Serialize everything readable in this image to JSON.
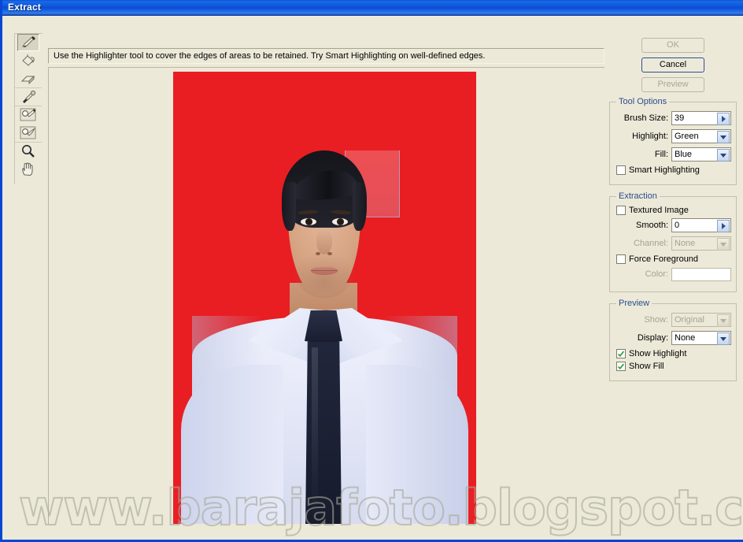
{
  "window": {
    "title": "Extract",
    "accent_titlebar": "#0b51d8",
    "panel_bg": "#ece9d8",
    "group_label_color": "#2b4b8f"
  },
  "hint": {
    "text": "Use the Highlighter tool to cover the edges of areas to be retained. Try Smart Highlighting on well-defined edges."
  },
  "toolbar": {
    "tools": [
      {
        "name": "highlighter-tool",
        "icon": "highlighter-icon",
        "selected": true
      },
      {
        "name": "fill-tool",
        "icon": "paint-bucket-icon",
        "selected": false
      },
      {
        "name": "eraser-tool",
        "icon": "eraser-icon",
        "selected": false
      },
      {
        "name": "eyedropper-tool",
        "icon": "eyedropper-icon",
        "selected": false
      },
      {
        "name": "cleanup-tool",
        "icon": "cleanup-brush-icon",
        "selected": false
      },
      {
        "name": "edge-touchup-tool",
        "icon": "edge-touchup-icon",
        "selected": false
      },
      {
        "name": "zoom-tool",
        "icon": "magnifier-icon",
        "selected": false
      },
      {
        "name": "hand-tool",
        "icon": "hand-icon",
        "selected": false
      }
    ]
  },
  "buttons": {
    "ok": "OK",
    "cancel": "Cancel",
    "preview": "Preview"
  },
  "tool_options": {
    "legend": "Tool Options",
    "brush_size_label": "Brush Size:",
    "brush_size_value": "39",
    "highlight_label": "Highlight:",
    "highlight_value": "Green",
    "fill_label": "Fill:",
    "fill_value": "Blue",
    "smart_highlighting_label": "Smart Highlighting"
  },
  "extraction": {
    "legend": "Extraction",
    "textured_image_label": "Textured Image",
    "smooth_label": "Smooth:",
    "smooth_value": "0",
    "channel_label": "Channel:",
    "channel_value": "None",
    "force_foreground_label": "Force Foreground",
    "color_label": "Color:"
  },
  "preview": {
    "legend": "Preview",
    "show_label": "Show:",
    "show_value": "Original",
    "display_label": "Display:",
    "display_value": "None",
    "show_highlight_label": "Show Highlight",
    "show_fill_label": "Show Fill"
  },
  "canvas": {
    "photo_background_color": "#e81e23",
    "watermark": "www.barajafoto.blogspot.com"
  }
}
